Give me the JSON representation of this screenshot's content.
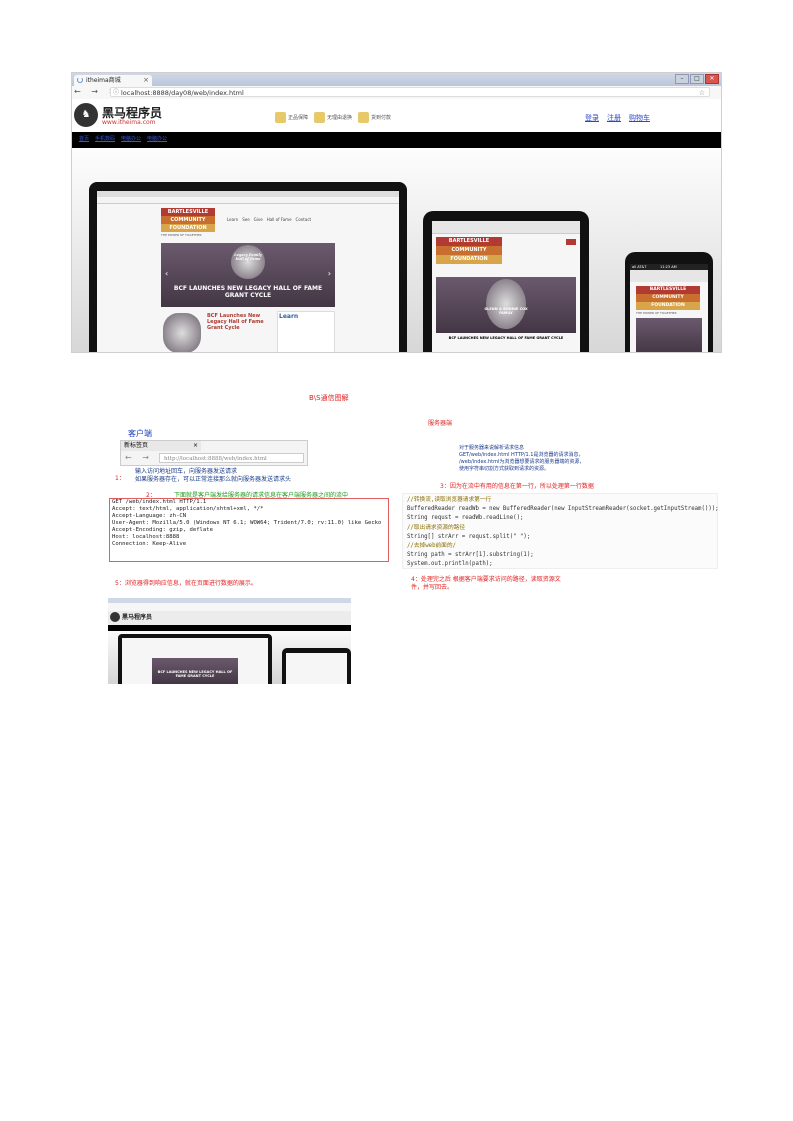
{
  "browser_top": {
    "tab_title": "itheima商城",
    "tab_close": "×",
    "nav_buttons": "← → ✕",
    "url": "localhost:8888/day08/web/index.html",
    "info_icon": "ⓘ",
    "star_icon": "☆",
    "window_buttons": [
      "–",
      "□",
      "✕"
    ],
    "site": {
      "logo_text": "黑马程序员",
      "logo_sub": "www.itheima.com",
      "badges": [
        "正品保障",
        "无理由退换",
        "货到付款"
      ],
      "links": [
        "登录",
        "注册",
        "购物车"
      ],
      "menu_items": [
        "首页",
        "手机数码",
        "电脑办公",
        "电脑办公"
      ],
      "laptop": {
        "brand_line1": "BARTLESVILLE",
        "brand_line2": "COMMUNITY",
        "brand_line3": "FOUNDATION",
        "tagline": "THE POWER OF TOGETHER",
        "nav": [
          "Learn",
          "See",
          "Give",
          "Hall of Fame",
          "Contact"
        ],
        "slide_caption": "BCF LAUNCHES NEW LEGACY HALL OF FAME GRANT CYCLE",
        "slide_award": "Legacy Family Hall of Fame",
        "article_title": "BCF Launches New Legacy Hall of Fame Grant Cycle",
        "side_title": "Learn"
      },
      "tablet": {
        "brand_line1": "BARTLESVILLE",
        "brand_line2": "COMMUNITY",
        "brand_line3": "FOUNDATION",
        "slide_caption": "BCF LAUNCHES NEW LEGACY HALL OF FAME GRANT CYCLE",
        "award_names": "GLENN & BONNIE COX FAMILY"
      },
      "phone": {
        "status_left": "all AT&T",
        "status_time": "11:23 AM",
        "brand_line1": "BARTLESVILLE",
        "brand_line2": "COMMUNITY",
        "brand_line3": "FOUNDATION",
        "tagline": "THE POWER OF TOGETHER"
      }
    }
  },
  "diagram": {
    "title": "B\\S通信图解",
    "server_label": "服务器端",
    "client_label": "客户端",
    "small_browser": {
      "tab_title": "新标签页",
      "tab_close": "×",
      "nav": "← → C",
      "url": "http://localhost:8888/web/index.html"
    },
    "step1_number": "1：",
    "step1_text_line1": "输入访问地址回车，向服务器发送请求",
    "step1_text_line2": "如果服务器存在，可以正常连接那么就向服务器发送请求头",
    "step2_number": "2：",
    "step2_text": "下面就是客户端发给服务器的请求信息在客户端服务器之间的流中",
    "request_lines": [
      "GET /web/index.html HTTP/1.1",
      "Accept: text/html, application/xhtml+xml, */*",
      "Accept-Language: zh-CN",
      "User-Agent: Mozilla/5.0 (Windows NT 6.1; WOW64; Trident/7.0; rv:11.0) like Gecko",
      "Accept-Encoding: gzip, deflate",
      "Host: localhost:8888",
      "Connection: Keep-Alive"
    ],
    "server_note_lines": [
      "对于服务器来说解析请求信息",
      "GET/web/index.html HTTP/1.1是浏览器的请求消息，",
      "/web/index.html为浏览器想要请求的服务器端的资源，",
      "使用字符串切割方式获取到请求的资源。"
    ],
    "step3_text": "3：因为在流中有用的信息在第一行，所以处理第一行数据",
    "code_lines": [
      {
        "kind": "cm",
        "text": "//转换流,读取浏览器请求第一行"
      },
      {
        "kind": "code",
        "text": "BufferedReader readWb = new BufferedReader(new InputStreamReader(socket.getInputStream()));"
      },
      {
        "kind": "code",
        "text": "String requst = readWb.readLine();"
      },
      {
        "kind": "cm",
        "text": "//取出请求资源的路径"
      },
      {
        "kind": "code",
        "text": "String[] strArr = requst.split(\" \");"
      },
      {
        "kind": "cm",
        "text": "//去掉web前面的/"
      },
      {
        "kind": "code",
        "text": "String path = strArr[1].substring(1);"
      },
      {
        "kind": "code",
        "text": "System.out.println(path);"
      }
    ],
    "step4_line1": "4：处理完之后 根据客户端要求访问的路径，读取资源文",
    "step4_line2": "件，并写回去。",
    "step5_text": "5：浏览器得到响应信息，就在页面进行数据的展示。",
    "result_shot": {
      "logo_text": "黑马程序员",
      "slide_caption": "BCF LAUNCHES NEW LEGACY HALL OF FAME GRANT CYCLE"
    }
  }
}
